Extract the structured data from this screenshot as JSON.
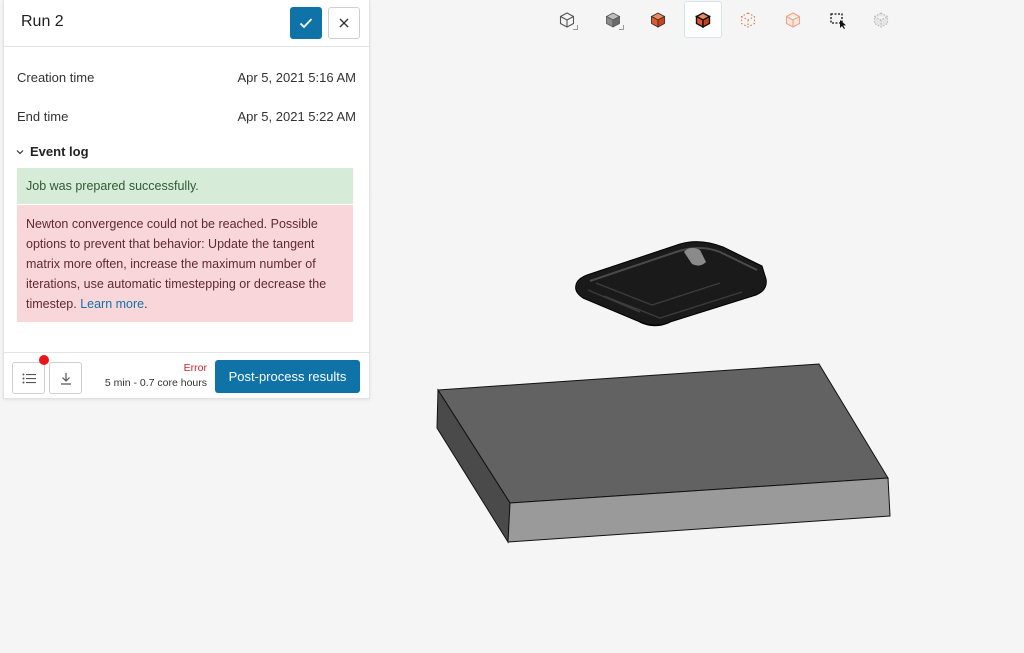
{
  "panel": {
    "title": "Run 2",
    "confirm_icon": "checkmark-icon",
    "close_icon": "close-icon",
    "details": [
      {
        "label": "Creation time",
        "value": "Apr 5, 2021 5:16 AM"
      },
      {
        "label": "End time",
        "value": "Apr 5, 2021 5:22 AM"
      }
    ],
    "event_log": {
      "title": "Event log",
      "success_message": "Job was prepared successfully.",
      "error_message": "Newton convergence could not be reached. Possible options to prevent that behavior: Update the tangent matrix more often, increase the maximum number of iterations, use automatic timestepping or decrease the timestep.",
      "learn_more": "Learn more",
      "trailing": "."
    },
    "footer": {
      "status": "Error",
      "meta": "5 min - 0.7 core hours",
      "post_process_label": "Post-process results"
    }
  },
  "toolbar": {
    "tools": [
      {
        "icon": "wireframe-cube-icon"
      },
      {
        "icon": "solid-cube-icon"
      },
      {
        "icon": "orange-solid-cube-icon"
      },
      {
        "icon": "cube-edges-icon",
        "active": true
      },
      {
        "icon": "dotted-cube-icon"
      },
      {
        "icon": "transparent-cube-icon"
      },
      {
        "icon": "box-select-icon"
      },
      {
        "icon": "grey-dotted-cube-icon"
      }
    ]
  },
  "colors": {
    "accent": "#0f73a8",
    "success_bg": "#d6ecd9",
    "error_bg": "#f8d6d9",
    "error_text": "#d0222b",
    "viewport_bg": "#f5f5f5"
  }
}
